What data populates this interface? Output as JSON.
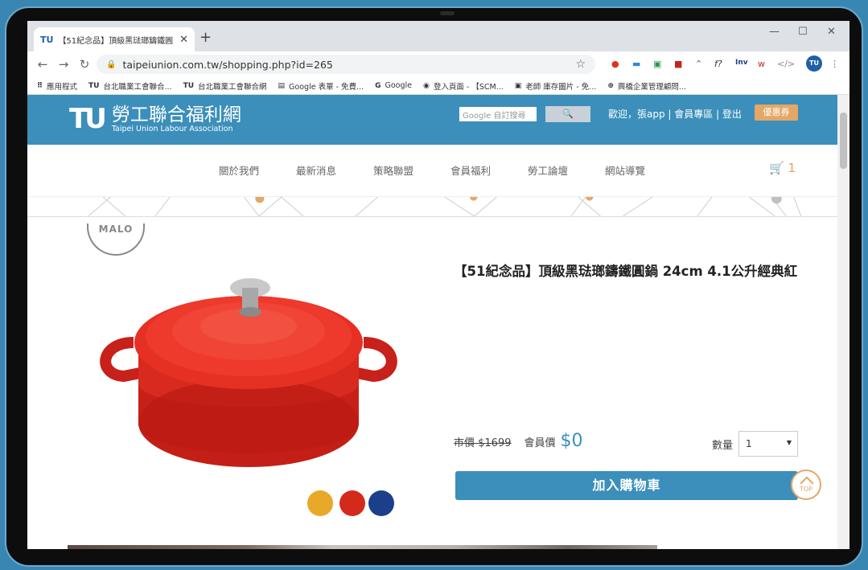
{
  "browser": {
    "tab_favicon": "TU",
    "tab_title": "【51紀念品】頂級黑琺瑯鑄鐵圓",
    "url": "taipeiunion.com.tw/shopping.php?id=265",
    "bookmarks": [
      {
        "icon": "⠿",
        "label": "應用程式"
      },
      {
        "icon": "TU",
        "label": "台北職業工會聯合..."
      },
      {
        "icon": "TU",
        "label": "台北職業工會聯合網"
      },
      {
        "icon": "▤",
        "label": "Google 表單 - 免費..."
      },
      {
        "icon": "G",
        "label": "Google"
      },
      {
        "icon": "◉",
        "label": "登入頁面 - 【SCM..."
      },
      {
        "icon": "▣",
        "label": "老師 庫存圖片 - 免..."
      },
      {
        "icon": "⊕",
        "label": "興橋企業管理顧問..."
      }
    ]
  },
  "site": {
    "logo_mark": "TU",
    "logo_name": "勞工聯合福利網",
    "logo_en": "Taipei Union Labour Association",
    "search_placeholder": "Google 自訂搜尋",
    "user_links": "歡迎，張app | 會員專區 | 登出",
    "coupon": "優惠券",
    "nav": [
      "關於我們",
      "最新消息",
      "策略聯盟",
      "會員福利",
      "勞工論壇",
      "網站導覽"
    ],
    "cart_count": "1"
  },
  "product": {
    "brand_badge": "MALO",
    "title": "【51紀念品】頂級黑琺瑯鑄鐵圓鍋 24cm 4.1公升經典紅",
    "list_price": "市價 $1699",
    "member_label": "會員價",
    "member_price": "$0",
    "qty_label": "數量",
    "qty_value": "1",
    "add_to_cart": "加入購物車",
    "top_label": "TOP",
    "swatches": [
      "#e8a828",
      "#d42a1c",
      "#1c3f8c"
    ]
  }
}
